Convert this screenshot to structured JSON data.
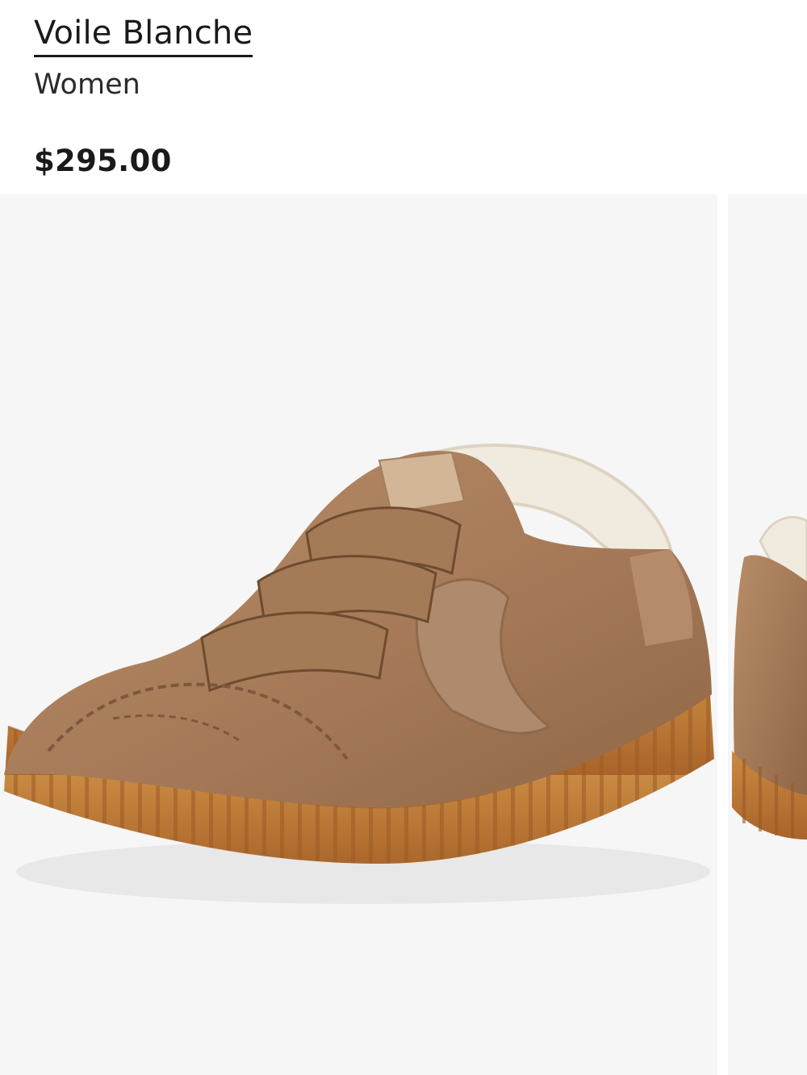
{
  "product": {
    "brand": "Voile Blanche",
    "category": "Women",
    "price": "$295.00"
  },
  "gallery": {
    "images": [
      {
        "alt_icon": "sneaker-image"
      },
      {
        "alt_icon": "sneaker-image"
      }
    ]
  },
  "colors": {
    "background": "#f6f6f6",
    "suede": "#a97d59",
    "sole": "#b8732f",
    "shearling": "#f1ebdf",
    "text": "#1a1a1a"
  }
}
